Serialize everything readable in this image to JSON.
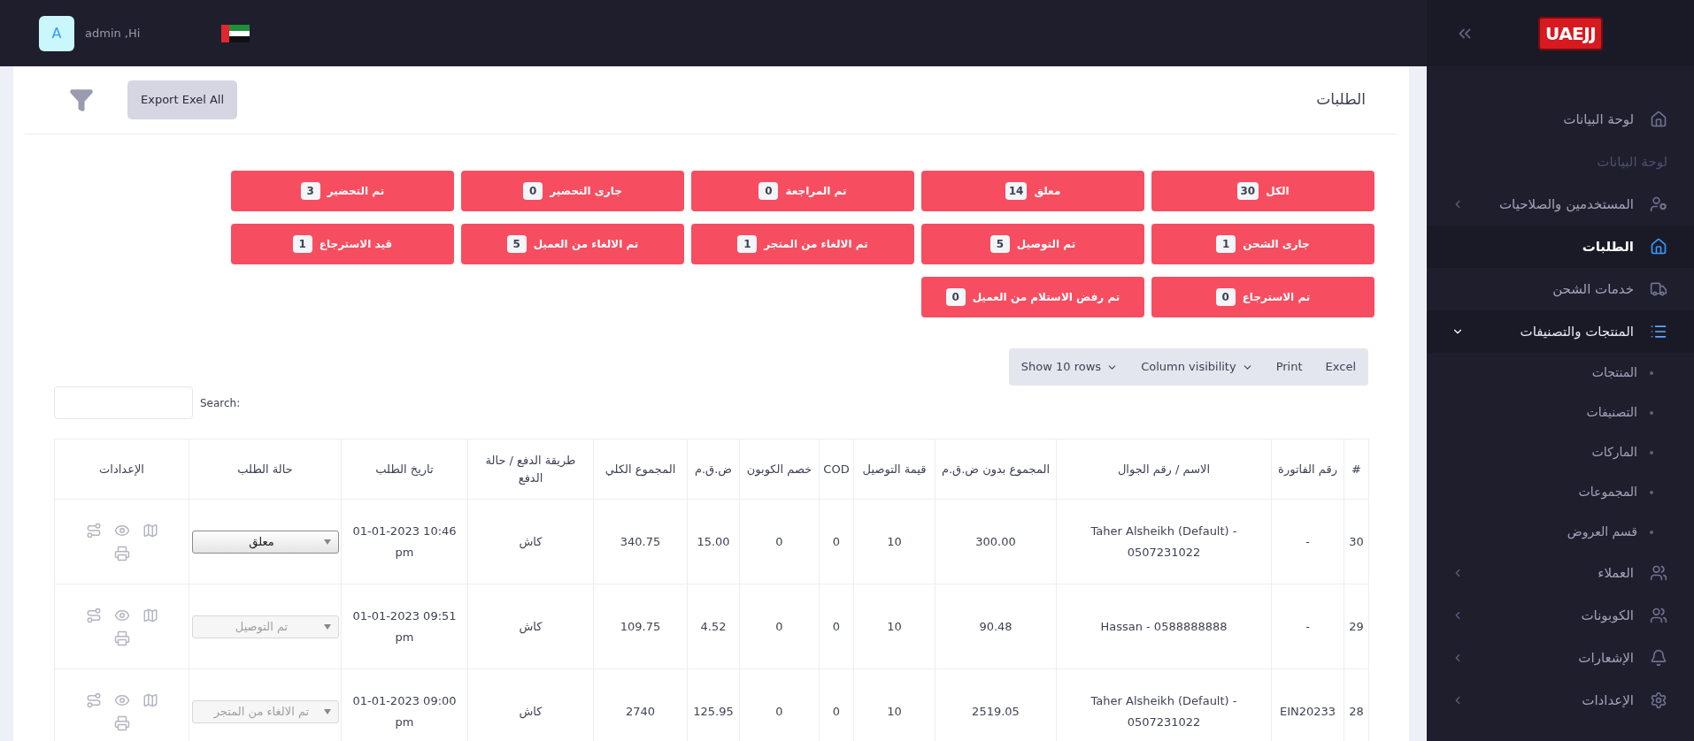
{
  "header": {
    "avatar": "A",
    "greeting": "admin ,Hi"
  },
  "sidebar": {
    "logo": "UAEJJ",
    "items": [
      {
        "kind": "link",
        "label": "لوحة البيانات",
        "selected": false
      },
      {
        "kind": "heading",
        "label": "لوحة البيانات"
      },
      {
        "kind": "link",
        "label": "المستخدمين والصلاحيات",
        "selected": false,
        "expanded": false
      },
      {
        "kind": "link",
        "label": "الطلبات",
        "selected": true
      },
      {
        "kind": "link",
        "label": "خدمات الشحن",
        "selected": false
      },
      {
        "kind": "link",
        "label": "المنتجات والتصنيفات",
        "selected": false,
        "expanded": true,
        "children": [
          {
            "label": "المنتجات"
          },
          {
            "label": "التصنيفات"
          },
          {
            "label": "الماركات"
          },
          {
            "label": "المجموعات"
          },
          {
            "label": "قسم العروض"
          }
        ]
      },
      {
        "kind": "link",
        "label": "العملاء",
        "selected": false,
        "expanded": false
      },
      {
        "kind": "link",
        "label": "الكوبونات",
        "selected": false,
        "expanded": false
      },
      {
        "kind": "link",
        "label": "الإشعارات",
        "selected": false,
        "expanded": false
      },
      {
        "kind": "link",
        "label": "الإعدادات",
        "selected": false,
        "expanded": false
      }
    ]
  },
  "page": {
    "title": "الطلبات",
    "export_button": "Export Exel All"
  },
  "status_filters": [
    {
      "label": "الكل",
      "count": "30"
    },
    {
      "label": "معلق",
      "count": "14"
    },
    {
      "label": "تم المراجعة",
      "count": "0"
    },
    {
      "label": "جارى التحضير",
      "count": "0"
    },
    {
      "label": "تم التحضير",
      "count": "3"
    },
    {
      "label": "جارى الشحن",
      "count": "1"
    },
    {
      "label": "تم التوصيل",
      "count": "5"
    },
    {
      "label": "تم الالغاء من المتجر",
      "count": "1"
    },
    {
      "label": "تم الالغاء من العميل",
      "count": "5"
    },
    {
      "label": "قيد الاسترجاع",
      "count": "1"
    },
    {
      "label": "تم الاسترجاع",
      "count": "0"
    },
    {
      "label": "تم رفض الاستلام من العميل",
      "count": "0"
    }
  ],
  "toolbar": [
    {
      "kind": "button",
      "label": "Excel"
    },
    {
      "kind": "button",
      "label": "Print"
    },
    {
      "kind": "dropdown",
      "label": "Column visibility"
    },
    {
      "kind": "dropdown",
      "label": "Show 10 rows"
    }
  ],
  "search": {
    "label": "Search:"
  },
  "table": {
    "columns": [
      "#",
      "رقم الفاتورة",
      "الاسم / رقم الجوال",
      "المجموع بدون ض.ق.م",
      "قيمة التوصيل",
      "COD",
      "خصم الكوبون",
      "ض.ق.م",
      "المجموع الكلي",
      "طريقة الدفع / حالة الدفع",
      "تاريخ الطلب",
      "حالة الطلب",
      "الإعدادات"
    ],
    "rows": [
      {
        "cells": [
          "30",
          "-",
          "Taher Alsheikh (Default) - 0507231022",
          "300.00",
          "10",
          "0",
          "0",
          "15.00",
          "340.75",
          "كاش",
          "10:46 01-01-2023 pm"
        ],
        "status": {
          "value": "معلق",
          "disabled": false
        }
      },
      {
        "cells": [
          "29",
          "-",
          "Hassan - 0588888888",
          "90.48",
          "10",
          "0",
          "0",
          "4.52",
          "109.75",
          "كاش",
          "09:51 01-01-2023 pm"
        ],
        "status": {
          "value": "تم التوصيل",
          "disabled": true
        }
      },
      {
        "cells": [
          "28",
          "EIN20233",
          "Taher Alsheikh (Default) - 0507231022",
          "2519.05",
          "10",
          "0",
          "0",
          "125.95",
          "2740",
          "كاش",
          "09:00 01-01-2023 pm"
        ],
        "status": {
          "value": "تم الالغاء من المتجر",
          "disabled": true
        }
      }
    ]
  }
}
